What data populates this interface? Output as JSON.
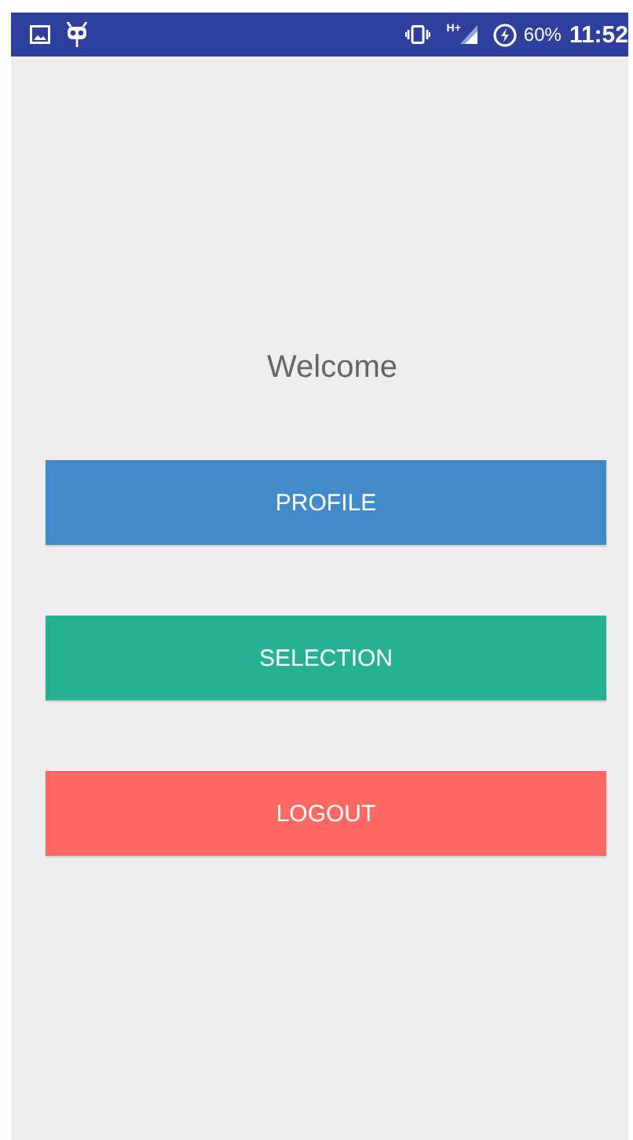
{
  "status_bar": {
    "network_type": "H+",
    "battery": "60%",
    "time": "11:52"
  },
  "welcome": "Welcome",
  "buttons": [
    {
      "label": "PROFILE",
      "color": "#428bca"
    },
    {
      "label": "SELECTION",
      "color": "#26b291"
    },
    {
      "label": "LOGOUT",
      "color": "#ff6961"
    }
  ]
}
